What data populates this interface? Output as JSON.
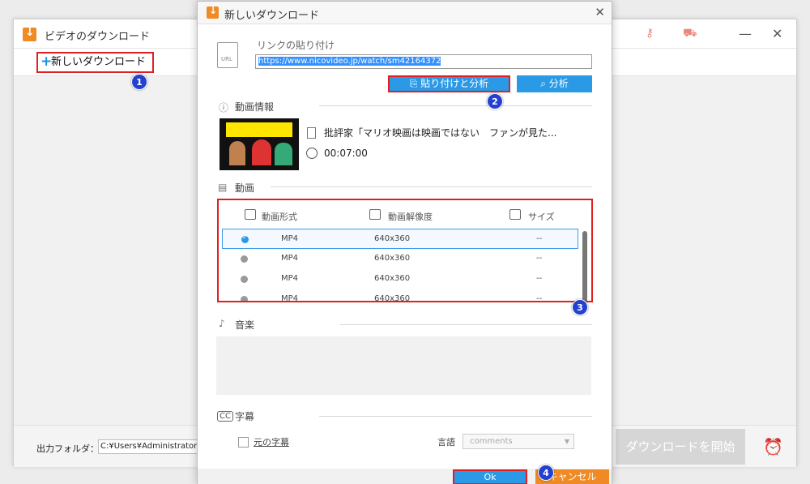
{
  "main_window": {
    "title": "ビデオのダウンロード",
    "new_download_label": "新しいダウンロード",
    "output_folder_label": "出力フォルダ：",
    "output_folder_path": "C:¥Users¥Administrator¥Des",
    "start_download_label": "ダウンロードを開始"
  },
  "dialog": {
    "title": "新しいダウンロード",
    "link_label": "リンクの貼り付け",
    "url_value": "https://www.nicovideo.jp/watch/sm42164372",
    "paste_analyze_label": "貼り付けと分析",
    "analyze_label": "分析",
    "video_info_label": "動画情報",
    "video_title": "批評家「マリオ映画は映画ではない　ファンが見た...",
    "video_duration": "00:07:00",
    "video_section_label": "動画",
    "table": {
      "headers": [
        "動画形式",
        "動画解像度",
        "サイズ"
      ],
      "rows": [
        {
          "format": "MP4",
          "resolution": "640x360",
          "size": "--",
          "selected": true
        },
        {
          "format": "MP4",
          "resolution": "640x360",
          "size": "--",
          "selected": false
        },
        {
          "format": "MP4",
          "resolution": "640x360",
          "size": "--",
          "selected": false
        },
        {
          "format": "MP4",
          "resolution": "640x360",
          "size": "--",
          "selected": false
        }
      ]
    },
    "audio_label": "音楽",
    "subtitle_label": "字幕",
    "original_subtitle_label": "元の字幕",
    "language_label": "言語",
    "language_value": "comments",
    "ok_label": "Ok",
    "cancel_label": "キャンセル"
  },
  "badges": [
    "1",
    "2",
    "3",
    "4"
  ],
  "colors": {
    "accent_blue": "#2b9ae6",
    "highlight_red": "#e02020",
    "orange": "#f08a24",
    "badge_blue": "#2340d0"
  }
}
